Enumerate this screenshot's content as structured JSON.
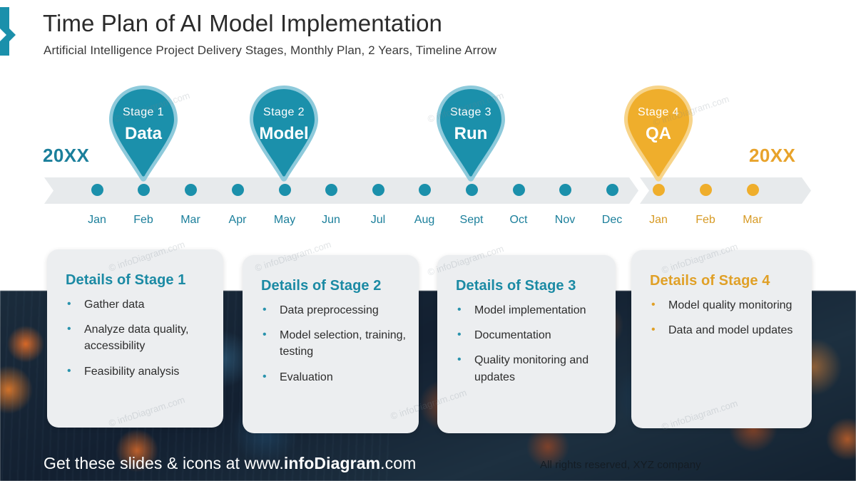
{
  "header": {
    "title": "Time Plan of AI Model Implementation",
    "subtitle": "Artificial Intelligence Project Delivery Stages, Monthly Plan, 2 Years, Timeline Arrow"
  },
  "timeline": {
    "year_start": "20XX",
    "year_end": "20XX",
    "months_year1": [
      "Jan",
      "Feb",
      "Mar",
      "Apr",
      "May",
      "Jun",
      "Jul",
      "Aug",
      "Sept",
      "Oct",
      "Nov",
      "Dec"
    ],
    "months_year2": [
      "Jan",
      "Feb",
      "Mar"
    ]
  },
  "stages": [
    {
      "stage_label": "Stage 1",
      "name": "Data",
      "color": "#1b90ab"
    },
    {
      "stage_label": "Stage  2",
      "name": "Model",
      "color": "#1b90ab"
    },
    {
      "stage_label": "Stage 3",
      "name": "Run",
      "color": "#1b90ab"
    },
    {
      "stage_label": "Stage 4",
      "name": "QA",
      "color": "#efae2c"
    }
  ],
  "cards": [
    {
      "title": "Details of Stage 1",
      "items": [
        "Gather data",
        "Analyze data quality, accessibility",
        "Feasibility analysis"
      ]
    },
    {
      "title": "Details of Stage 2",
      "items": [
        "Data preprocessing",
        "Model selection, training, testing",
        "Evaluation"
      ]
    },
    {
      "title": "Details of Stage 3",
      "items": [
        "Model implementation",
        "Documentation",
        "Quality monitoring and updates"
      ]
    },
    {
      "title": "Details of Stage 4",
      "items": [
        "Model quality monitoring",
        "Data and model updates"
      ]
    }
  ],
  "footer": {
    "cta_prefix": "Get these slides & icons at www.",
    "cta_brand": "infoDiagram",
    "cta_suffix": ".com",
    "rights": "All rights reserved, XYZ company"
  },
  "watermark": {
    "text": "© infoDiagram.com"
  },
  "colors": {
    "teal": "#1b90ab",
    "teal_dark": "#1b7f9b",
    "teal_light": "#8ecadb",
    "orange": "#efae2c",
    "orange_dark": "#d79a24",
    "band_gray": "#e7eaec",
    "card_gray": "#eceef0"
  }
}
